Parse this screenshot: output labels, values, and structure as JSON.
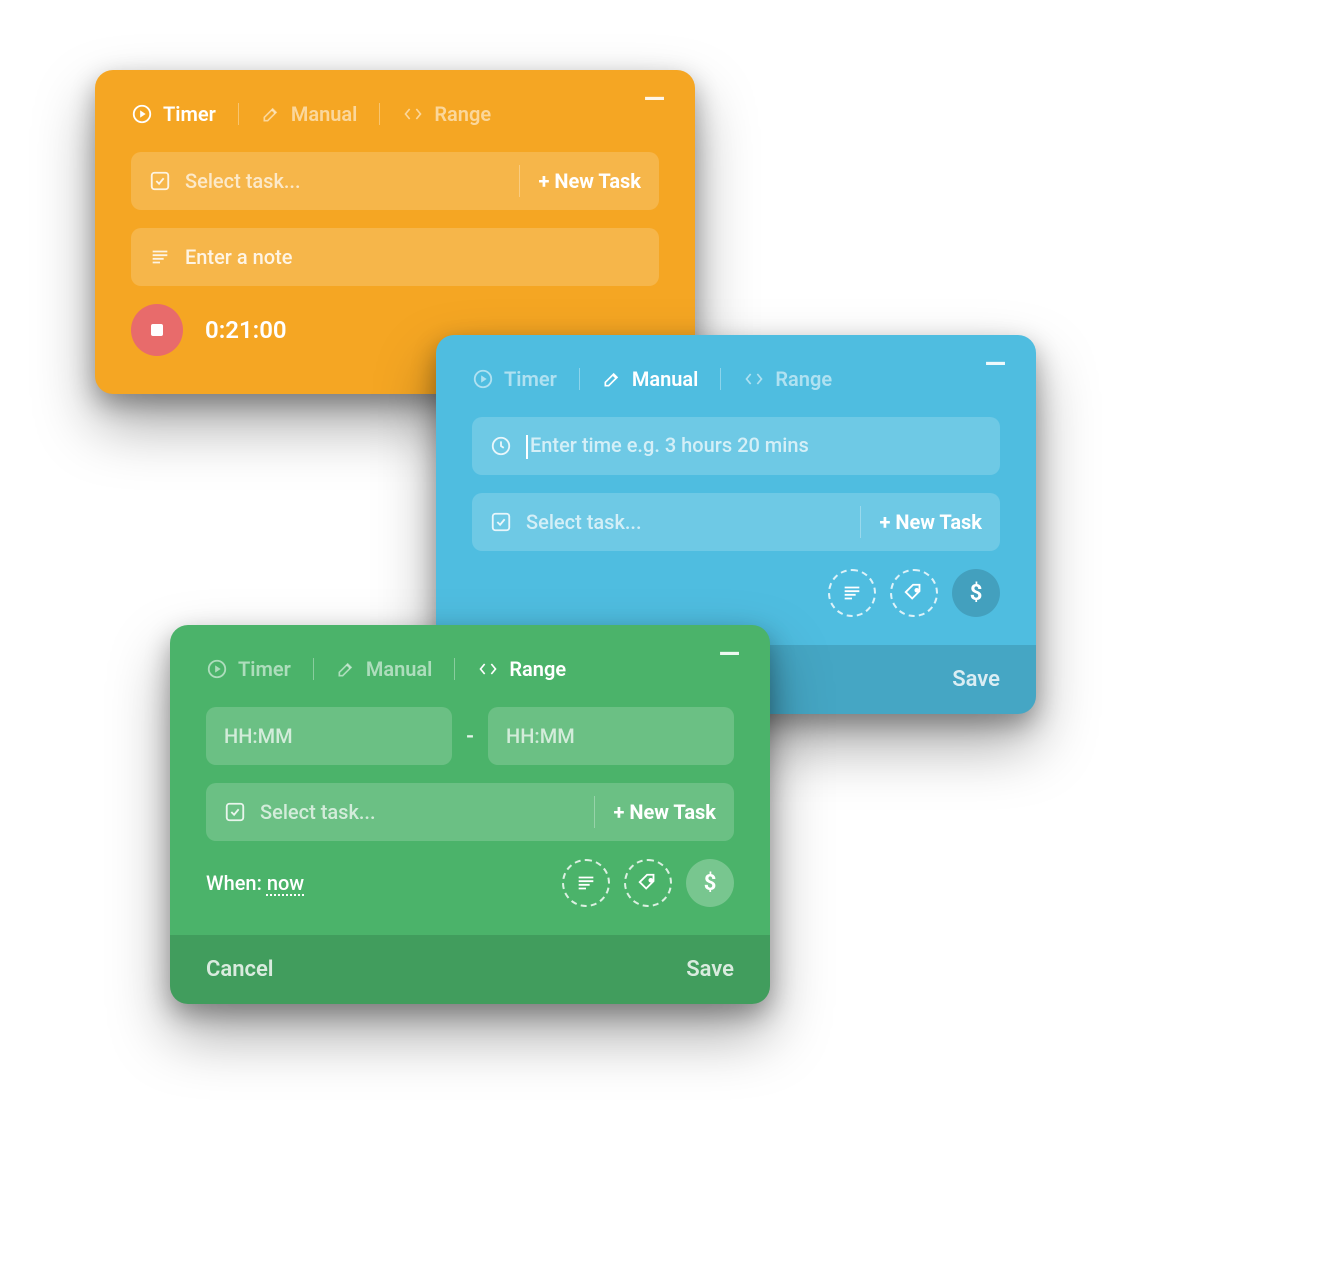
{
  "tabs": {
    "timer": "Timer",
    "manual": "Manual",
    "range": "Range"
  },
  "common": {
    "select_task": "Select task...",
    "new_task": "+ New Task",
    "cancel": "Cancel",
    "save": "Save"
  },
  "orange": {
    "note_placeholder": "Enter a note",
    "elapsed": "0:21:00"
  },
  "blue": {
    "time_placeholder": "Enter time e.g. 3 hours 20 mins"
  },
  "green": {
    "hhmm": "HH:MM",
    "range_sep": "-",
    "when_label": "When:",
    "when_value": "now"
  },
  "icons": {
    "dollar": "$"
  }
}
